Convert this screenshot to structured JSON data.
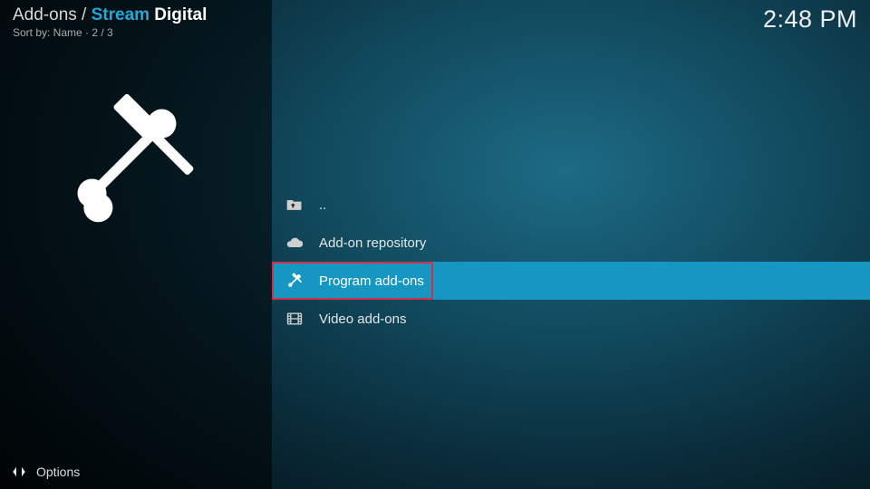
{
  "header": {
    "breadcrumb_prefix": "Add-ons / ",
    "title_accent": "Stream",
    "title_rest": " Digital",
    "sort_label": "Sort by: Name",
    "sort_sep": "  ·  ",
    "position": "2 / 3",
    "clock": "2:48 PM"
  },
  "list": {
    "items": [
      {
        "label": "..",
        "icon": "folder-up-icon",
        "selected": false
      },
      {
        "label": "Add-on repository",
        "icon": "cloud-icon",
        "selected": false
      },
      {
        "label": "Program add-ons",
        "icon": "tools-icon",
        "selected": true
      },
      {
        "label": "Video add-ons",
        "icon": "film-icon",
        "selected": false
      }
    ]
  },
  "footer": {
    "options_label": "Options"
  }
}
